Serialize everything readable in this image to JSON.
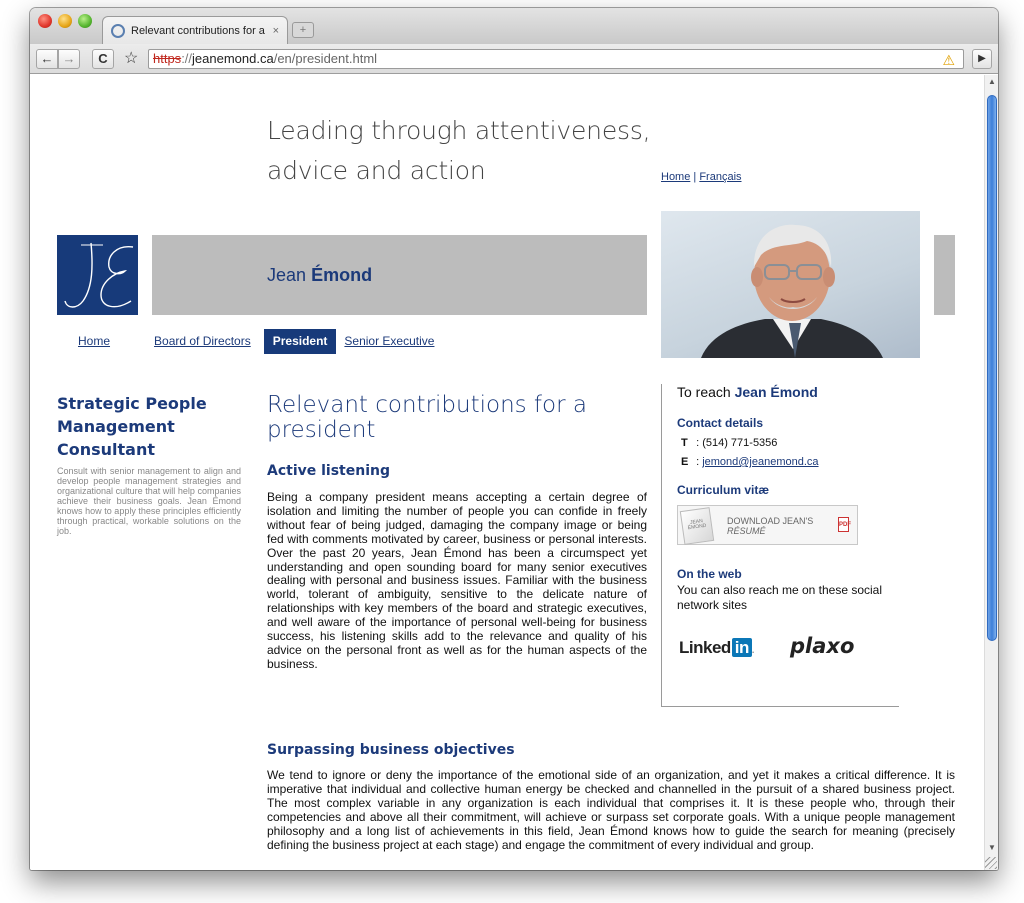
{
  "browser": {
    "tab_title": "Relevant contributions for a",
    "tab_close": "×",
    "new_tab": "+",
    "back": "←",
    "forward": "→",
    "reload": "C",
    "star": "☆",
    "url": {
      "scheme": "https",
      "sep": "://",
      "host": "jeanemond.ca",
      "path": "/en/president.html"
    },
    "warning": "⚠",
    "menu": "▶"
  },
  "header": {
    "tagline_line1": "Leading through attentiveness,",
    "tagline_line2": "advice and action",
    "link_home": "Home",
    "link_sep": "|",
    "link_french": "Français",
    "name_first": "Jean",
    "name_last": "Émond",
    "logo_text": "JE"
  },
  "nav": {
    "items": [
      {
        "label": "Home"
      },
      {
        "label": "Board of Directors"
      },
      {
        "label": "President"
      },
      {
        "label": "Senior Executive"
      }
    ],
    "active": "President"
  },
  "sidebar": {
    "title": "Strategic People Management Consultant",
    "text": "Consult with senior management to align and develop people management strategies and organizational culture that will help companies achieve their business goals. Jean Émond knows how to apply these principles efficiently through practical, workable solutions on the job."
  },
  "main": {
    "title": "Relevant contributions for a president",
    "sections": [
      {
        "heading": "Active listening",
        "body": "Being a company president means accepting a certain degree of isolation and limiting the number of people you can confide in freely without fear of being judged, damaging the company image or being fed with comments motivated by career, business or personal interests. Over the past 20 years, Jean Émond has been a circumspect yet understanding and open sounding board for many senior executives dealing with personal and business issues. Familiar with the business world, tolerant of ambiguity, sensitive to the delicate nature of relationships with key members of the board and strategic executives, and well aware of the importance of personal well-being for business success, his listening skills add to the relevance and quality of his advice on the personal front as well as for the human aspects of the business."
      },
      {
        "heading": "Surpassing business objectives",
        "body": "We tend to ignore or deny the importance of the emotional side of an organization, and yet it makes a critical difference. It is imperative that individual and collective human energy be checked and channelled in the pursuit of a shared business project. The most complex variable in any organization is each individual that comprises it. It is these people who, through their competencies and above all their commitment, will achieve or surpass set corporate goals. With a unique people management philosophy and a long list of achievements in this field, Jean Émond knows how to guide the search for meaning (precisely defining the business project at each stage) and engage the commitment of every individual and group."
      }
    ]
  },
  "contact": {
    "reach_prefix": "To reach",
    "reach_name": "Jean Émond",
    "details_heading": "Contact details",
    "phone_label": "T",
    "phone_sep": ":",
    "phone": "(514) 771-5356",
    "email_label": "E",
    "email_sep": ":",
    "email": "jemond@jeanemond.ca",
    "cv_heading": "Curriculum vitæ",
    "cv_doc_text": "JEAN ÉMOND",
    "cv_line1": "DOWNLOAD JEAN'S",
    "cv_line2": "RÉSUMÉ",
    "pdf_label": "PDF",
    "web_heading": "On the web",
    "web_text": "You can also reach me on these social network sites",
    "linkedin_a": "Linked",
    "linkedin_b": "in",
    "linkedin_dot": ".",
    "plaxo": "plaxo"
  },
  "colors": {
    "brand_navy": "#173a7a",
    "banner_gray": "#bcbcbc",
    "link_blue": "#1c3a7a"
  }
}
